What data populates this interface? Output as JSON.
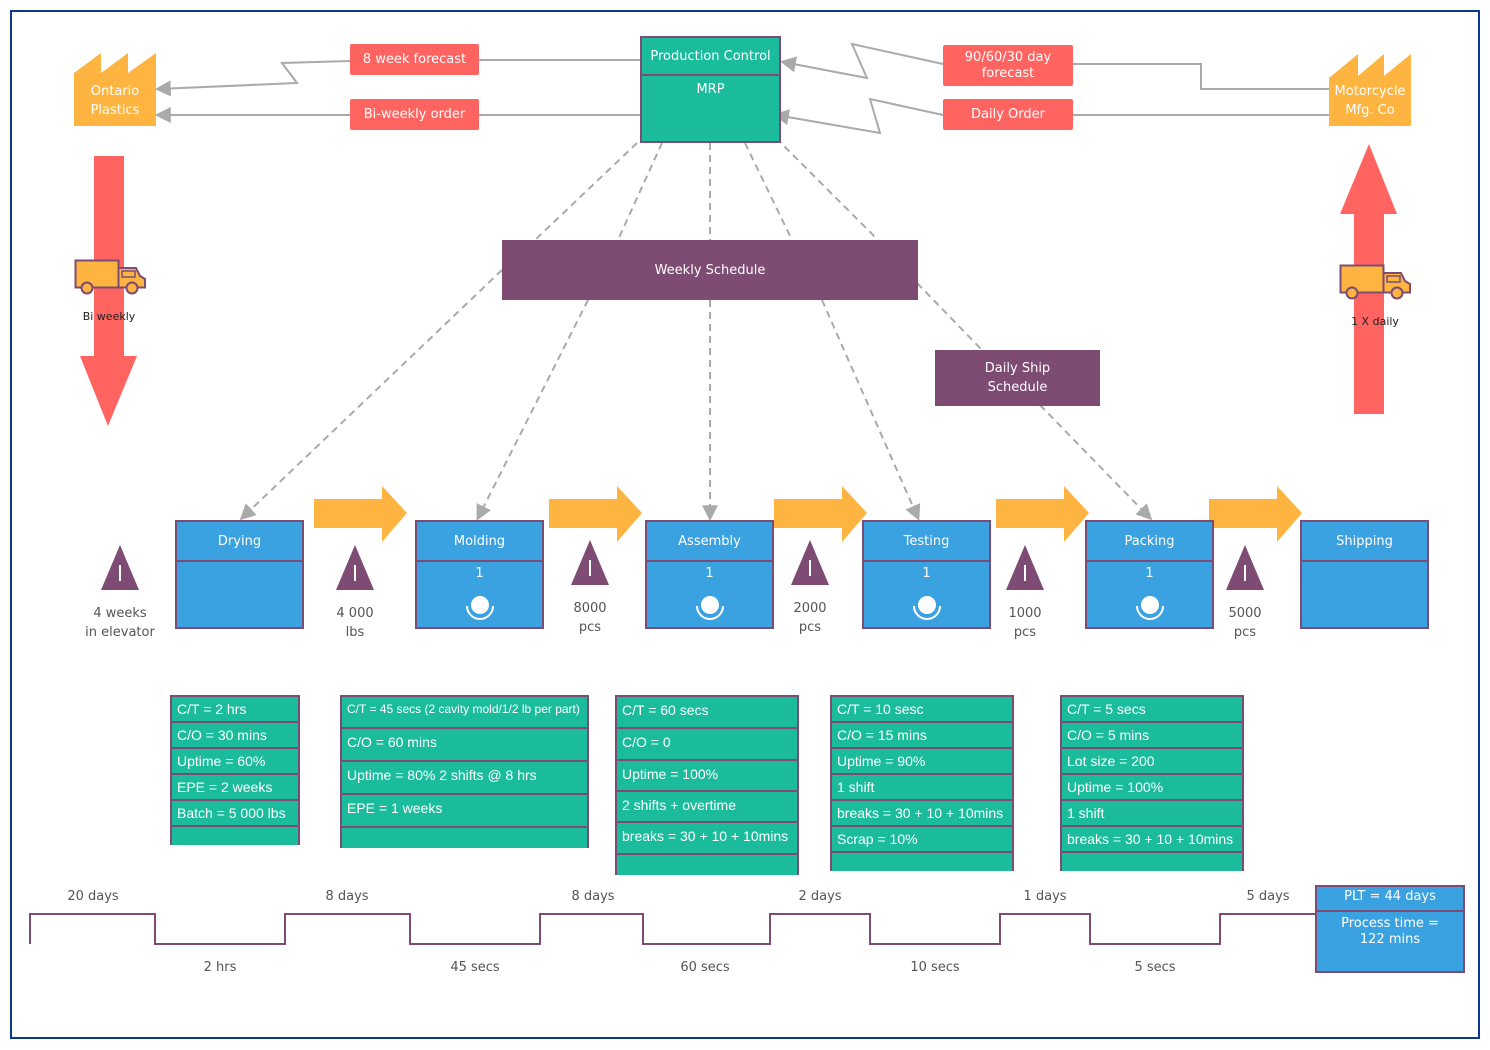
{
  "colors": {
    "process_fill": "#3aa2e0",
    "data_fill": "#1abc9c",
    "border_purple": "#7d4b73",
    "tag_red": "#ff6461",
    "factory_orange": "#fdb441",
    "schedule_purple": "#7e4b73",
    "connector_gray": "#aaaaaa",
    "frame_blue": "#0b3a8c"
  },
  "supplier": {
    "name_line1": "Ontario",
    "name_line2": "Plastics",
    "icon": "factory-icon"
  },
  "customer": {
    "name_line1": "Motorcycle",
    "name_line2": "Mfg. Co",
    "icon": "factory-icon"
  },
  "production_control": {
    "title": "Production Control",
    "subtitle": "MRP"
  },
  "info_flows": {
    "supplier_forecast": "8 week forecast",
    "supplier_order": "Bi-weekly order",
    "customer_forecast_line1": "90/60/30 day",
    "customer_forecast_line2": "forecast",
    "customer_order": "Daily Order"
  },
  "schedules": {
    "weekly": "Weekly Schedule",
    "daily_ship_line1": "Daily Ship",
    "daily_ship_line2": "Schedule"
  },
  "shipments": {
    "inbound": {
      "label": "Bi weekly",
      "icon": "truck-icon",
      "direction": "down"
    },
    "outbound": {
      "label": "1 X daily",
      "icon": "truck-icon",
      "direction": "up"
    }
  },
  "processes": [
    {
      "name": "Drying",
      "operators": ""
    },
    {
      "name": "Molding",
      "operators": "1"
    },
    {
      "name": "Assembly",
      "operators": "1"
    },
    {
      "name": "Testing",
      "operators": "1"
    },
    {
      "name": "Packing",
      "operators": "1"
    },
    {
      "name": "Shipping",
      "operators": ""
    }
  ],
  "inventories": [
    {
      "line1": "4 weeks",
      "line2": "in elevator"
    },
    {
      "line1": "4 000",
      "line2": "lbs"
    },
    {
      "line1": "8000",
      "line2": "pcs"
    },
    {
      "line1": "2000",
      "line2": "pcs"
    },
    {
      "line1": "1000",
      "line2": "pcs"
    },
    {
      "line1": "5000",
      "line2": "pcs"
    }
  ],
  "data_boxes": [
    {
      "process": "Drying",
      "rows": [
        "C/T = 2 hrs",
        "C/O = 30 mins",
        "Uptime = 60%",
        "EPE = 2 weeks",
        "Batch = 5 000 lbs",
        ""
      ]
    },
    {
      "process": "Molding",
      "rows": [
        "C/T = 45 secs (2 cavity mold/1/2 lb per part)",
        "C/O = 60 mins",
        "Uptime = 80% 2 shifts @ 8 hrs",
        "EPE = 1 weeks",
        ""
      ]
    },
    {
      "process": "Assembly",
      "rows": [
        "C/T = 60 secs",
        "C/O = 0",
        "Uptime = 100%",
        "2 shifts + overtime",
        "breaks = 30 + 10 + 10mins",
        ""
      ]
    },
    {
      "process": "Testing",
      "rows": [
        "C/T = 10 sesc",
        "C/O = 15 mins",
        "Uptime = 90%",
        "1 shift",
        "breaks = 30 + 10 + 10mins",
        "Scrap = 10%",
        ""
      ]
    },
    {
      "process": "Packing",
      "rows": [
        "C/T = 5 secs",
        "C/O = 5 mins",
        "Lot size = 200",
        "Uptime = 100%",
        "1 shift",
        "breaks = 30 + 10 + 10mins",
        ""
      ]
    }
  ],
  "timeline": {
    "wait_times": [
      "20 days",
      "8 days",
      "8 days",
      "2 days",
      "1 days",
      "5 days"
    ],
    "process_times": [
      "2 hrs",
      "45 secs",
      "60 secs",
      "10 secs",
      "5 secs"
    ]
  },
  "summary": {
    "plt": "PLT = 44 days",
    "process_time_line1": "Process time =",
    "process_time_line2": "122 mins"
  }
}
